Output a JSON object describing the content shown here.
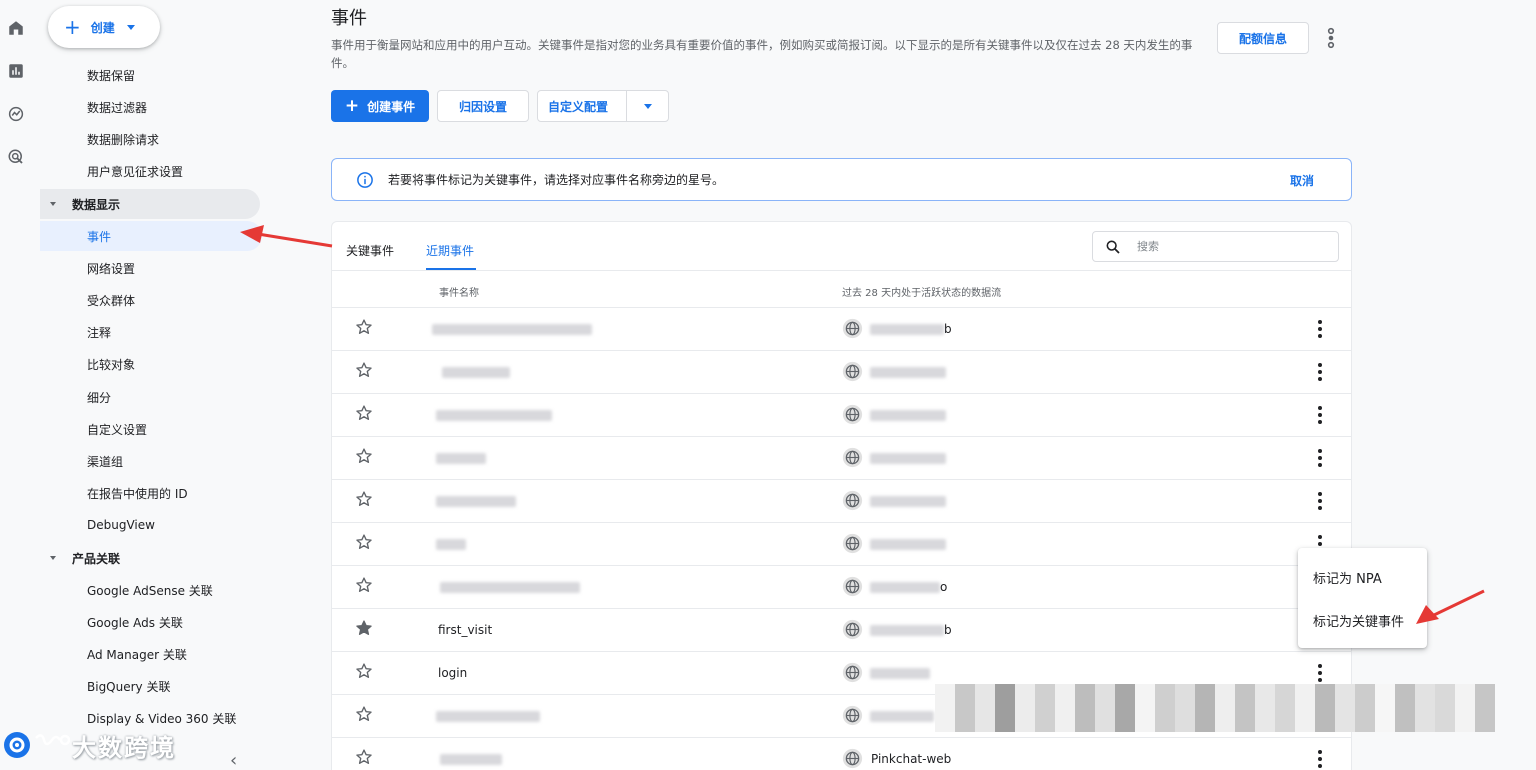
{
  "app": {
    "accent": "#1a73e8"
  },
  "rail": {
    "icons": [
      "home-icon",
      "reports-icon",
      "explore-icon",
      "advertising-icon"
    ]
  },
  "sidebar": {
    "create_label": "创建",
    "items": [
      {
        "label": "数据保留",
        "kind": "sub"
      },
      {
        "label": "数据过滤器",
        "kind": "sub"
      },
      {
        "label": "数据删除请求",
        "kind": "sub"
      },
      {
        "label": "用户意见征求设置",
        "kind": "sub"
      },
      {
        "label": "数据显示",
        "kind": "group"
      },
      {
        "label": "事件",
        "kind": "sub",
        "active": true
      },
      {
        "label": "网络设置",
        "kind": "sub"
      },
      {
        "label": "受众群体",
        "kind": "sub"
      },
      {
        "label": "注释",
        "kind": "sub"
      },
      {
        "label": "比较对象",
        "kind": "sub"
      },
      {
        "label": "细分",
        "kind": "sub"
      },
      {
        "label": "自定义设置",
        "kind": "sub"
      },
      {
        "label": "渠道组",
        "kind": "sub"
      },
      {
        "label": "在报告中使用的 ID",
        "kind": "sub"
      },
      {
        "label": "DebugView",
        "kind": "sub"
      },
      {
        "label": "产品关联",
        "kind": "group"
      },
      {
        "label": "Google AdSense 关联",
        "kind": "sub"
      },
      {
        "label": "Google Ads 关联",
        "kind": "sub"
      },
      {
        "label": "Ad Manager 关联",
        "kind": "sub"
      },
      {
        "label": "BigQuery 关联",
        "kind": "sub"
      },
      {
        "label": "Display & Video 360 关联",
        "kind": "sub"
      }
    ]
  },
  "header": {
    "title": "事件",
    "description": "事件用于衡量网站和应用中的用户互动。关键事件是指对您的业务具有重要价值的事件，例如购买或简报订阅。以下显示的是所有关键事件以及仅在过去 28 天内发生的事件。",
    "quota_label": "配额信息"
  },
  "toolbar": {
    "create_event_label": "创建事件",
    "attribution_label": "归因设置",
    "custom_config_label": "自定义配置"
  },
  "banner": {
    "text": "若要将事件标记为关键事件，请选择对应事件名称旁边的星号。",
    "cancel_label": "取消"
  },
  "table": {
    "tabs": [
      "关键事件",
      "近期事件"
    ],
    "active_tab": 1,
    "search_placeholder": "搜索",
    "columns": [
      "事件名称",
      "过去 28 天内处于活跃状态的数据流"
    ],
    "rows": [
      {
        "name": "",
        "stream": "b",
        "starred": false
      },
      {
        "name": "",
        "stream": "",
        "starred": false
      },
      {
        "name": "",
        "stream": "",
        "starred": false
      },
      {
        "name": "",
        "stream": "",
        "starred": false
      },
      {
        "name": "",
        "stream": "",
        "starred": false
      },
      {
        "name": "",
        "stream": "",
        "starred": false
      },
      {
        "name": "",
        "stream": "o",
        "starred": false
      },
      {
        "name": "first_visit",
        "stream": "b",
        "starred": true
      },
      {
        "name": "login",
        "stream": "",
        "starred": false
      },
      {
        "name": "",
        "stream": "",
        "starred": false
      },
      {
        "name": "",
        "stream": "Pinkchat-web",
        "starred": false
      }
    ]
  },
  "context_menu": {
    "items": [
      "标记为 NPA",
      "标记为关键事件"
    ]
  },
  "watermark": {
    "text": "大数跨境"
  }
}
